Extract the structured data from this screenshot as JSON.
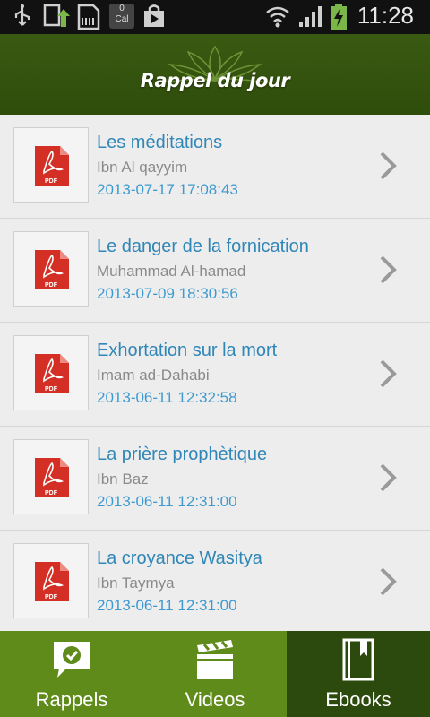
{
  "status_bar": {
    "calendar_count": "0",
    "calendar_label": "Cal",
    "time": "11:28",
    "icons": [
      "usb-icon",
      "upload-icon",
      "sd-card-icon",
      "calendar-icon",
      "play-store-icon",
      "wifi-icon",
      "signal-icon",
      "battery-charging-icon"
    ]
  },
  "header": {
    "title": "Rappel du jour",
    "background_color": "#2f4d0b"
  },
  "ebooks": [
    {
      "title": "Les méditations",
      "author": "Ibn Al qayyim",
      "date": "2013-07-17 17:08:43",
      "icon": "pdf-icon",
      "icon_label": "PDF"
    },
    {
      "title": "Le danger de la fornication",
      "author": "Muhammad Al-hamad",
      "date": "2013-07-09 18:30:56",
      "icon": "pdf-icon",
      "icon_label": "PDF"
    },
    {
      "title": "Exhortation sur la mort",
      "author": "Imam ad-Dahabi",
      "date": "2013-06-11 12:32:58",
      "icon": "pdf-icon",
      "icon_label": "PDF"
    },
    {
      "title": "La prière prophètique",
      "author": "Ibn Baz",
      "date": "2013-06-11 12:31:00",
      "icon": "pdf-icon",
      "icon_label": "PDF"
    },
    {
      "title": "La croyance Wasitya",
      "author": "Ibn Taymya",
      "date": "2013-06-11 12:31:00",
      "icon": "pdf-icon",
      "icon_label": "PDF"
    }
  ],
  "tabs": [
    {
      "label": "Rappels",
      "icon": "chat-check-icon",
      "active": false
    },
    {
      "label": "Videos",
      "icon": "clapperboard-icon",
      "active": false
    },
    {
      "label": "Ebooks",
      "icon": "book-icon",
      "active": true
    }
  ],
  "colors": {
    "accent_green": "#5f8b1b",
    "active_tab": "#2d4a0e",
    "title_blue": "#2f86b7",
    "date_blue": "#3d9ad0"
  }
}
